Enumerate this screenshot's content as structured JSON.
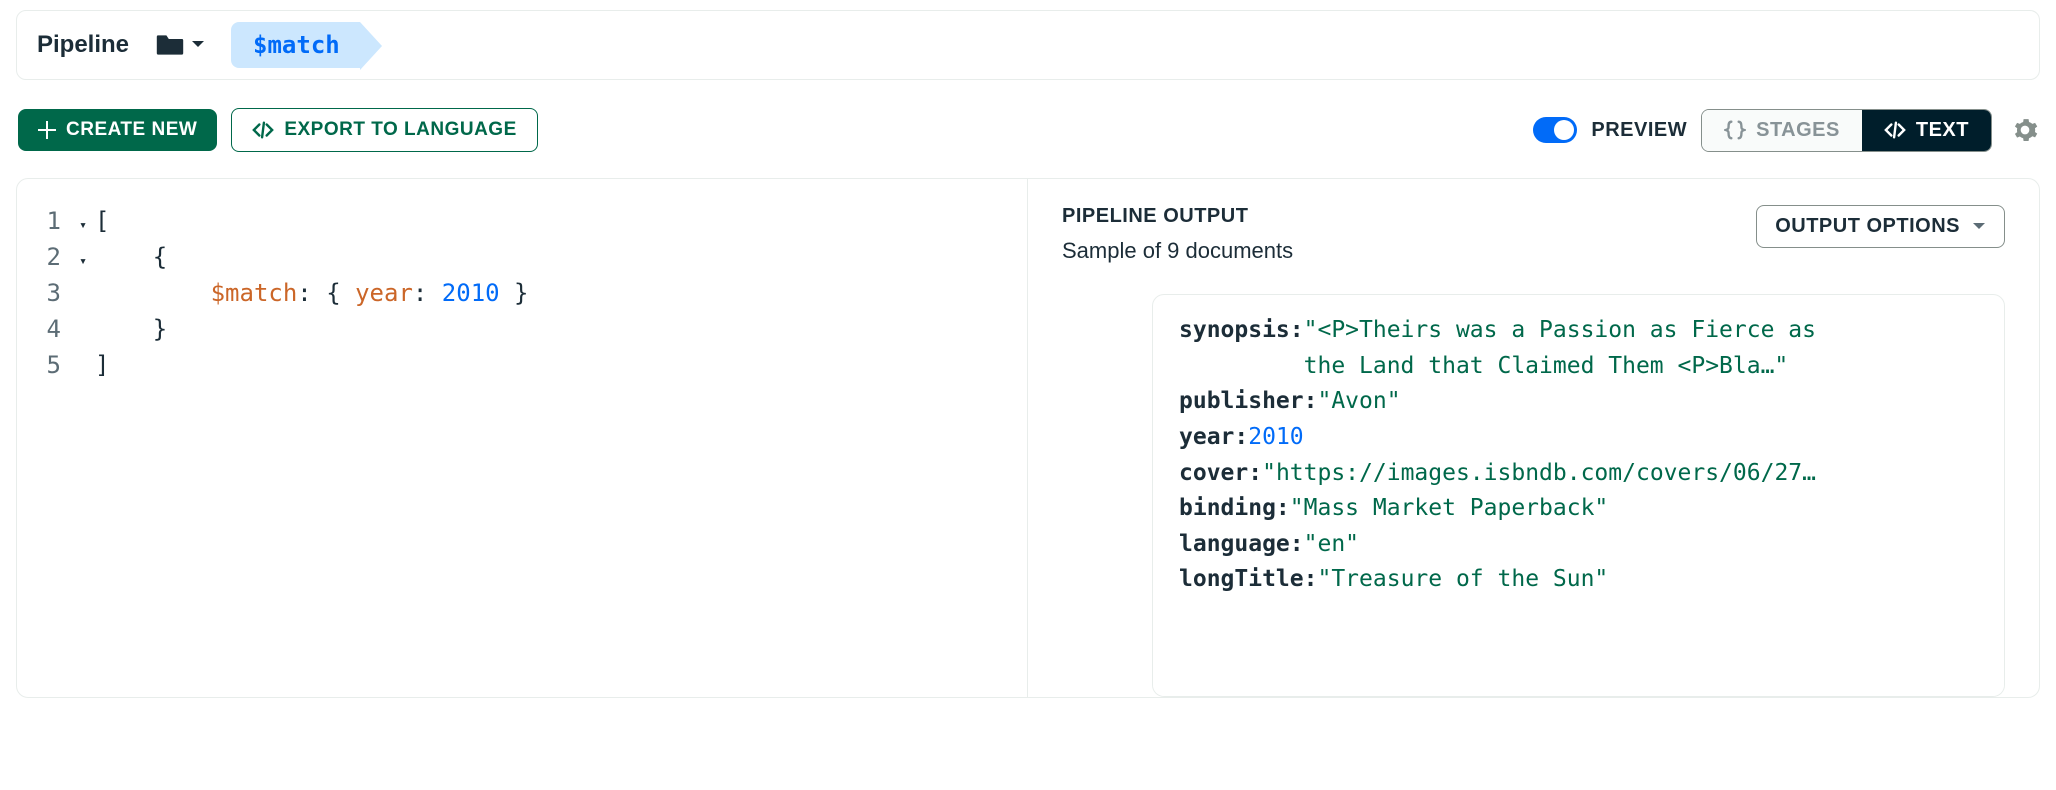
{
  "breadcrumb": {
    "title": "Pipeline",
    "stage": "$match"
  },
  "toolbar": {
    "create_label": "CREATE NEW",
    "export_label": "EXPORT TO LANGUAGE",
    "preview_label": "PREVIEW",
    "stages_label": "STAGES",
    "text_label": "TEXT"
  },
  "editor": {
    "lines": [
      {
        "n": "1",
        "fold": "▾",
        "tokens": [
          {
            "t": "[",
            "c": "tok-punc"
          }
        ]
      },
      {
        "n": "2",
        "fold": "▾",
        "tokens": [
          {
            "t": "    {",
            "c": "tok-punc"
          }
        ]
      },
      {
        "n": "3",
        "fold": "",
        "tokens": [
          {
            "t": "        ",
            "c": ""
          },
          {
            "t": "$match",
            "c": "tok-op"
          },
          {
            "t": ": { ",
            "c": "tok-punc"
          },
          {
            "t": "year",
            "c": "tok-key"
          },
          {
            "t": ": ",
            "c": "tok-punc"
          },
          {
            "t": "2010",
            "c": "tok-num"
          },
          {
            "t": " }",
            "c": "tok-punc"
          }
        ]
      },
      {
        "n": "4",
        "fold": "",
        "tokens": [
          {
            "t": "    }",
            "c": "tok-punc"
          }
        ]
      },
      {
        "n": "5",
        "fold": "",
        "tokens": [
          {
            "t": "]",
            "c": "tok-punc"
          }
        ]
      }
    ]
  },
  "output": {
    "title": "PIPELINE OUTPUT",
    "subtitle": "Sample of 9 documents",
    "options_label": "OUTPUT OPTIONS",
    "doc": [
      {
        "key": "synopsis",
        "type": "str",
        "value": "\"<P>Theirs was a Passion as Fierce as",
        "cont": "the Land that Claimed Them <P>Bla…\""
      },
      {
        "key": "publisher",
        "type": "str",
        "value": "\"Avon\""
      },
      {
        "key": "year",
        "type": "num",
        "value": "2010"
      },
      {
        "key": "cover",
        "type": "str",
        "value": "\"https://images.isbndb.com/covers/06/27…"
      },
      {
        "key": "binding",
        "type": "str",
        "value": "\"Mass Market Paperback\""
      },
      {
        "key": "language",
        "type": "str",
        "value": "\"en\""
      },
      {
        "key": "longTitle",
        "type": "str",
        "value": "\"Treasure of the Sun\""
      }
    ]
  }
}
